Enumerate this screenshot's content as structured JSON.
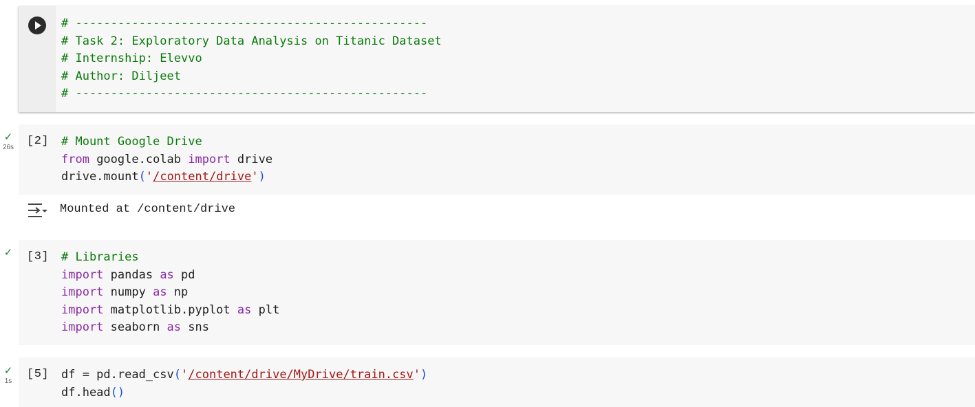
{
  "cells": [
    {
      "id": "cell-header",
      "lines": [
        [
          {
            "t": "# --------------------------------------------------",
            "c": "cm"
          }
        ],
        [
          {
            "t": "# Task 2: Exploratory Data Analysis on Titanic Dataset",
            "c": "cm"
          }
        ],
        [
          {
            "t": "# Internship: Elevvo",
            "c": "cm"
          }
        ],
        [
          {
            "t": "# Author: Diljeet",
            "c": "cm"
          }
        ],
        [
          {
            "t": "# --------------------------------------------------",
            "c": "cm"
          }
        ]
      ]
    },
    {
      "id": "cell-mount",
      "exec_count": "[2]",
      "status": {
        "check": "✓",
        "duration": "26s"
      },
      "lines": [
        [
          {
            "t": "# Mount Google Drive",
            "c": "cm"
          }
        ],
        [
          {
            "t": "from",
            "c": "kw"
          },
          {
            "t": " google.colab ",
            "c": ""
          },
          {
            "t": "import",
            "c": "kw"
          },
          {
            "t": " drive",
            "c": ""
          }
        ],
        [
          {
            "t": "drive.mount",
            "c": ""
          },
          {
            "t": "(",
            "c": "paren"
          },
          {
            "t": "'",
            "c": "q"
          },
          {
            "t": "/content/drive",
            "c": "str"
          },
          {
            "t": "'",
            "c": "q"
          },
          {
            "t": ")",
            "c": "paren"
          }
        ]
      ]
    },
    {
      "id": "cell-libraries",
      "exec_count": "[3]",
      "status": {
        "check": "✓",
        "duration": ""
      },
      "lines": [
        [
          {
            "t": "# Libraries",
            "c": "cm"
          }
        ],
        [
          {
            "t": "import",
            "c": "kw"
          },
          {
            "t": " pandas ",
            "c": ""
          },
          {
            "t": "as",
            "c": "kw"
          },
          {
            "t": " pd",
            "c": ""
          }
        ],
        [
          {
            "t": "import",
            "c": "kw"
          },
          {
            "t": " numpy ",
            "c": ""
          },
          {
            "t": "as",
            "c": "kw"
          },
          {
            "t": " np",
            "c": ""
          }
        ],
        [
          {
            "t": "import",
            "c": "kw"
          },
          {
            "t": " matplotlib.pyplot ",
            "c": ""
          },
          {
            "t": "as",
            "c": "kw"
          },
          {
            "t": " plt",
            "c": ""
          }
        ],
        [
          {
            "t": "import",
            "c": "kw"
          },
          {
            "t": " seaborn ",
            "c": ""
          },
          {
            "t": "as",
            "c": "kw"
          },
          {
            "t": " sns",
            "c": ""
          }
        ]
      ]
    },
    {
      "id": "cell-readcsv",
      "exec_count": "[5]",
      "status": {
        "check": "✓",
        "duration": "1s"
      },
      "lines": [
        [
          {
            "t": "df = pd.read_csv",
            "c": ""
          },
          {
            "t": "(",
            "c": "paren"
          },
          {
            "t": "'",
            "c": "q"
          },
          {
            "t": "/content/drive/MyDrive/train.csv",
            "c": "str"
          },
          {
            "t": "'",
            "c": "q"
          },
          {
            "t": ")",
            "c": "paren"
          }
        ],
        [
          {
            "t": "df.head",
            "c": ""
          },
          {
            "t": "()",
            "c": "paren"
          }
        ]
      ]
    }
  ],
  "outputs": {
    "mount_output": "Mounted at /content/drive",
    "output_icon": "output-actions-icon"
  }
}
